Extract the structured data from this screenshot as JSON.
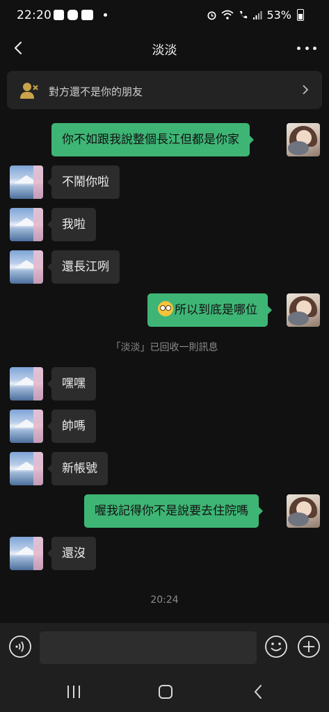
{
  "status_bar": {
    "time": "22:20",
    "battery": "53%"
  },
  "header": {
    "title": "淡淡"
  },
  "banner": {
    "text": "對方還不是你的朋友"
  },
  "messages": [
    {
      "side": "out",
      "text": "你不如跟我說整個長江但都是你家"
    },
    {
      "side": "in",
      "text": "不鬧你啦"
    },
    {
      "side": "in",
      "text": "我啦"
    },
    {
      "side": "in",
      "text": "還長江咧"
    },
    {
      "side": "out",
      "text": "所以到底是哪位"
    },
    {
      "side": "in",
      "text": "嘿嘿"
    },
    {
      "side": "in",
      "text": "帥嗎"
    },
    {
      "side": "in",
      "text": "新帳號"
    },
    {
      "side": "out",
      "text": "喔我記得你不是說要去住院嗎"
    },
    {
      "side": "in",
      "text": "還沒"
    }
  ],
  "recall_notice": "「淡淡」已回收一則訊息",
  "timestamp": "20:24",
  "input": {
    "value": ""
  },
  "colors": {
    "background": "#111111",
    "bubble_out": "#3eb575",
    "bubble_in": "#2c2c2c",
    "banner_icon": "#c9a44a"
  }
}
